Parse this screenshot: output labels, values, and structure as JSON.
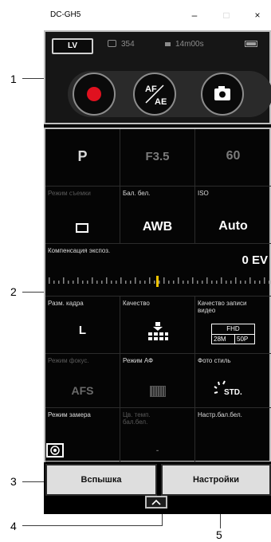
{
  "window": {
    "title": "DC-GH5",
    "minimize": "–",
    "maximize": "□",
    "close": "×"
  },
  "top_panel": {
    "lv_label": "LV",
    "shots_remaining": "354",
    "record_time": "14m00s",
    "af_ae_label": "AF\nAE"
  },
  "settings": {
    "shoot_mode_value": "P",
    "aperture_value": "F3.5",
    "shutter_value": "60",
    "drive_mode_label": "Режим съемки",
    "wb_label": "Бал. бел.",
    "wb_value": "AWB",
    "iso_label": "ISO",
    "iso_value": "Auto",
    "exposure_comp_label": "Компенсация экспоз.",
    "exposure_comp_value": "0 EV",
    "picture_size_label": "Разм. кадра",
    "picture_size_value": "L",
    "quality_label": "Качество",
    "video_quality_label": "Качество записи видео",
    "video_fhd": "FHD",
    "video_bitrate": "28M",
    "video_fps": "50P",
    "focus_mode_label": "Режим фокус.",
    "focus_mode_value": "AFS",
    "af_mode_label": "Режим АФ",
    "photo_style_label": "Фото стиль",
    "photo_style_value": "STD.",
    "metering_label": "Режим замера",
    "wb_temp_label": "Цв. темп. бал.бел.",
    "wb_temp_value": "-",
    "wb_setting_label": "Настр.бал.бел."
  },
  "bottom": {
    "flash_button": "Вспышка",
    "settings_button": "Настройки",
    "expand_icon": "^"
  },
  "callouts": [
    "1",
    "2",
    "3",
    "4",
    "5"
  ],
  "colors": {
    "record": "#e0111f",
    "highlight": "#f0c400",
    "accent_border": "#bfbfbf"
  }
}
